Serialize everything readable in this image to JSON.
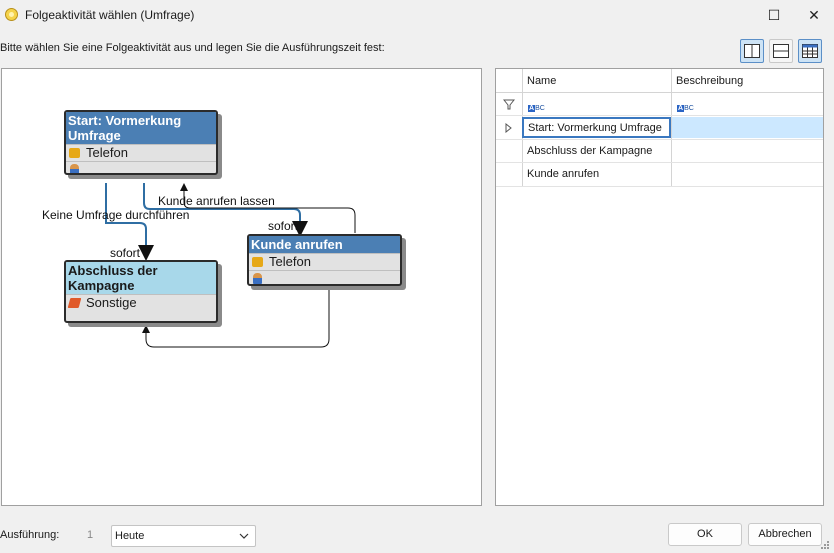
{
  "window": {
    "title": "Folgeaktivität wählen (Umfrage)",
    "maximize_glyph": "☐",
    "close_glyph": "✕"
  },
  "instruction": "Bitte wählen Sie eine Folgeaktivität aus und legen Sie die Ausführungszeit fest:",
  "view_buttons": [
    {
      "icon": "split-vertical-icon",
      "active": true
    },
    {
      "icon": "split-horizontal-icon",
      "active": false
    },
    {
      "icon": "grid-only-icon",
      "active": true
    }
  ],
  "diagram": {
    "nodes": [
      {
        "title": "Start: Vormerkung Umfrage",
        "rows": [
          {
            "icon": "phone-icon",
            "text": "Telefon"
          },
          {
            "icon": "person-icon",
            "text": ""
          }
        ]
      },
      {
        "title": "Kunde anrufen",
        "rows": [
          {
            "icon": "phone-icon",
            "text": "Telefon"
          },
          {
            "icon": "person-icon",
            "text": ""
          }
        ]
      },
      {
        "title": "Abschluss der Kampagne",
        "rows": [
          {
            "icon": "misc-icon",
            "text": "Sonstige"
          }
        ]
      }
    ],
    "edge_labels": {
      "keine_umfrage": "Keine Umfrage durchführen",
      "kunde_lassen": "Kunde anrufen lassen",
      "sofort_1": "sofort",
      "sofort_2": "sofort"
    }
  },
  "grid": {
    "columns": [
      "Name",
      "Beschreibung"
    ],
    "filter_icon": "filter-icon",
    "rows": [
      {
        "name": "Start: Vormerkung Umfrage",
        "description": "",
        "selected": true
      },
      {
        "name": "Abschluss der Kampagne",
        "description": ""
      },
      {
        "name": "Kunde anrufen",
        "description": ""
      }
    ]
  },
  "footer": {
    "execution_label": "Ausführung:",
    "execution_number": "1",
    "execution_value": "Heute",
    "ok_label": "OK",
    "cancel_label": "Abbrechen"
  },
  "colors": {
    "node_header_dark": "#4b7fb4",
    "node_header_light": "#a8d8ea",
    "selection": "#cce8ff",
    "edge": "#2f6ea3"
  }
}
